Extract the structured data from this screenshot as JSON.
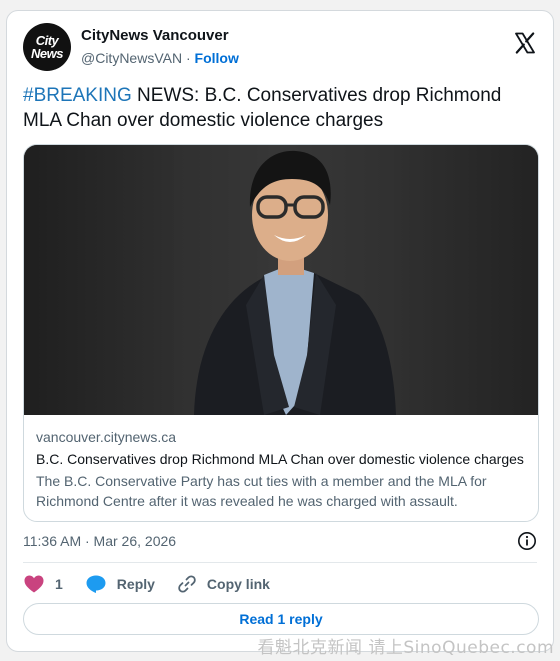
{
  "account": {
    "avatar_line1": "City",
    "avatar_line2": "News",
    "name": "CityNews Vancouver",
    "handle": "@CityNewsVAN",
    "separator": "·",
    "follow_label": "Follow"
  },
  "tweet": {
    "hashtag": "#BREAKING",
    "text": " NEWS: B.C. Conservatives drop Richmond MLA Chan over domestic violence charges"
  },
  "link_card": {
    "domain": "vancouver.citynews.ca",
    "title": "B.C. Conservatives drop Richmond MLA Chan over domestic violence charges",
    "description": "The B.C. Conservative Party has cut ties with a member and the MLA for Richmond Centre after it was revealed he was charged with assault."
  },
  "meta": {
    "timestamp": "11:36 AM · Mar 26, 2026"
  },
  "actions": {
    "like_count": "1",
    "reply_label": "Reply",
    "copy_label": "Copy link",
    "read_replies_label": "Read 1 reply"
  },
  "watermark": "看魁北克新闻 请上SinoQuebec.com",
  "colors": {
    "link_blue": "#006fd6",
    "hashtag_blue": "#1d75b8",
    "heart_pink": "#f91880",
    "reply_blue": "#1d9bf0",
    "muted_text": "#536471"
  }
}
